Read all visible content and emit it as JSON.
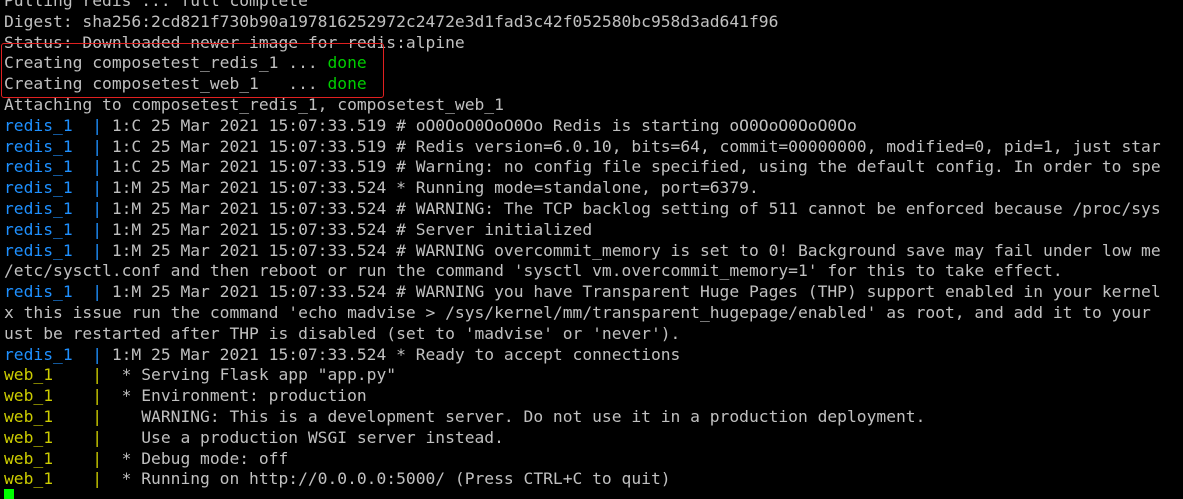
{
  "colors": {
    "background": "#000000",
    "text": "#c0c0c0",
    "service_redis": "#1e90ff",
    "service_web": "#cdcd00",
    "status_done": "#00cd00",
    "annotation_box": "#e02020",
    "cursor": "#00ff00"
  },
  "terminal": {
    "lines": [
      {
        "type": "plain",
        "text": "Pulling redis ... full complete"
      },
      {
        "type": "plain",
        "text": "Digest: sha256:2cd821f730b90a197816252972c2472e3d1fad3c42f052580bc958d3ad641f96"
      },
      {
        "type": "plain",
        "text": "Status: Downloaded newer image for redis:alpine"
      },
      {
        "type": "status",
        "text": "Creating composetest_redis_1 ... ",
        "status": "done"
      },
      {
        "type": "status",
        "text": "Creating composetest_web_1   ... ",
        "status": "done"
      },
      {
        "type": "plain",
        "text": "Attaching to composetest_redis_1, composetest_web_1"
      },
      {
        "type": "log",
        "service": "redis",
        "prefix": "redis_1  | ",
        "text": "1:C 25 Mar 2021 15:07:33.519 # oO0OoO0OoO0Oo Redis is starting oO0OoO0OoO0Oo"
      },
      {
        "type": "log",
        "service": "redis",
        "prefix": "redis_1  | ",
        "text": "1:C 25 Mar 2021 15:07:33.519 # Redis version=6.0.10, bits=64, commit=00000000, modified=0, pid=1, just star"
      },
      {
        "type": "log",
        "service": "redis",
        "prefix": "redis_1  | ",
        "text": "1:C 25 Mar 2021 15:07:33.519 # Warning: no config file specified, using the default config. In order to spe"
      },
      {
        "type": "log",
        "service": "redis",
        "prefix": "redis_1  | ",
        "text": "1:M 25 Mar 2021 15:07:33.524 * Running mode=standalone, port=6379."
      },
      {
        "type": "log",
        "service": "redis",
        "prefix": "redis_1  | ",
        "text": "1:M 25 Mar 2021 15:07:33.524 # WARNING: The TCP backlog setting of 511 cannot be enforced because /proc/sys"
      },
      {
        "type": "log",
        "service": "redis",
        "prefix": "redis_1  | ",
        "text": "1:M 25 Mar 2021 15:07:33.524 # Server initialized"
      },
      {
        "type": "log",
        "service": "redis",
        "prefix": "redis_1  | ",
        "text": "1:M 25 Mar 2021 15:07:33.524 # WARNING overcommit_memory is set to 0! Background save may fail under low me"
      },
      {
        "type": "plain",
        "text": "/etc/sysctl.conf and then reboot or run the command 'sysctl vm.overcommit_memory=1' for this to take effect."
      },
      {
        "type": "log",
        "service": "redis",
        "prefix": "redis_1  | ",
        "text": "1:M 25 Mar 2021 15:07:33.524 # WARNING you have Transparent Huge Pages (THP) support enabled in your kernel"
      },
      {
        "type": "plain",
        "text": "x this issue run the command 'echo madvise > /sys/kernel/mm/transparent_hugepage/enabled' as root, and add it to your"
      },
      {
        "type": "plain",
        "text": "ust be restarted after THP is disabled (set to 'madvise' or 'never')."
      },
      {
        "type": "log",
        "service": "redis",
        "prefix": "redis_1  | ",
        "text": "1:M 25 Mar 2021 15:07:33.524 * Ready to accept connections"
      },
      {
        "type": "log",
        "service": "web",
        "prefix": "web_1    | ",
        "text": " * Serving Flask app \"app.py\""
      },
      {
        "type": "log",
        "service": "web",
        "prefix": "web_1    | ",
        "text": " * Environment: production"
      },
      {
        "type": "log",
        "service": "web",
        "prefix": "web_1    | ",
        "text": "   WARNING: This is a development server. Do not use it in a production deployment."
      },
      {
        "type": "log",
        "service": "web",
        "prefix": "web_1    | ",
        "text": "   Use a production WSGI server instead."
      },
      {
        "type": "log",
        "service": "web",
        "prefix": "web_1    | ",
        "text": " * Debug mode: off"
      },
      {
        "type": "log",
        "service": "web",
        "prefix": "web_1    | ",
        "text": " * Running on http://0.0.0.0:5000/ (Press CTRL+C to quit)"
      }
    ]
  }
}
